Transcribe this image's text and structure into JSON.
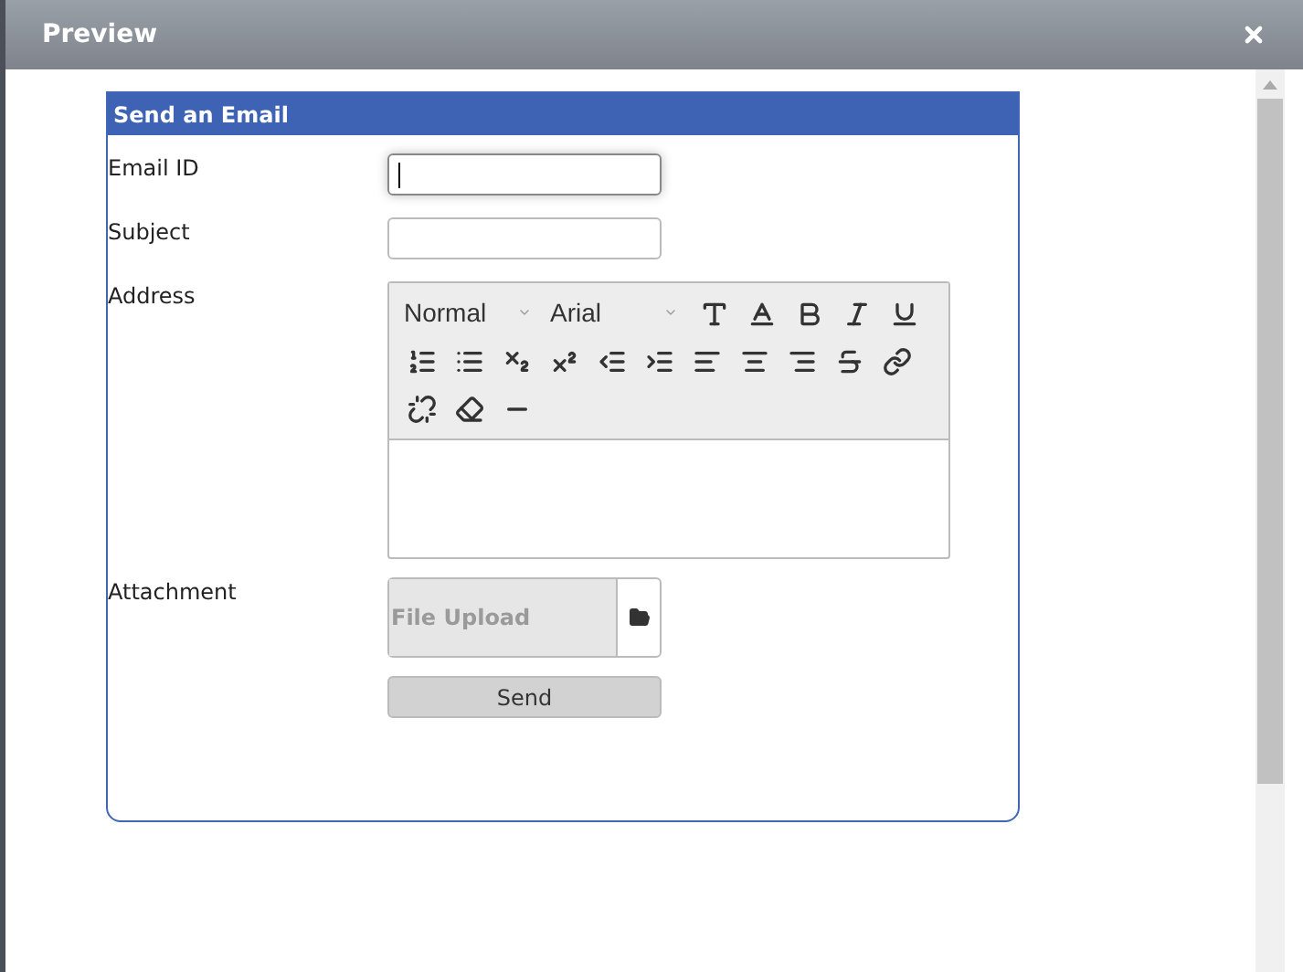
{
  "dialog": {
    "title": "Preview"
  },
  "form": {
    "title": "Send an Email",
    "fields": [
      {
        "label": "Email ID",
        "focused": true
      },
      {
        "label": "Subject",
        "focused": false
      }
    ],
    "address": {
      "label": "Address",
      "dropdowns": [
        {
          "value": "Normal"
        },
        {
          "value": "Arial"
        }
      ],
      "tools": [
        {
          "kind": "textsize"
        },
        {
          "kind": "fontcolor"
        },
        {
          "kind": "bold"
        },
        {
          "kind": "italic"
        },
        {
          "kind": "underline"
        },
        {
          "kind": "ordered"
        },
        {
          "kind": "bullets"
        },
        {
          "kind": "subscript"
        },
        {
          "kind": "superscript"
        },
        {
          "kind": "outdent"
        },
        {
          "kind": "indent"
        },
        {
          "kind": "left"
        },
        {
          "kind": "center"
        },
        {
          "kind": "right"
        },
        {
          "kind": "strike"
        },
        {
          "kind": "link"
        },
        {
          "kind": "unlink"
        },
        {
          "kind": "eraser"
        },
        {
          "kind": "rule"
        }
      ]
    },
    "attachment": {
      "label": "Attachment",
      "placeholder": "File Upload"
    },
    "button": "Send"
  }
}
